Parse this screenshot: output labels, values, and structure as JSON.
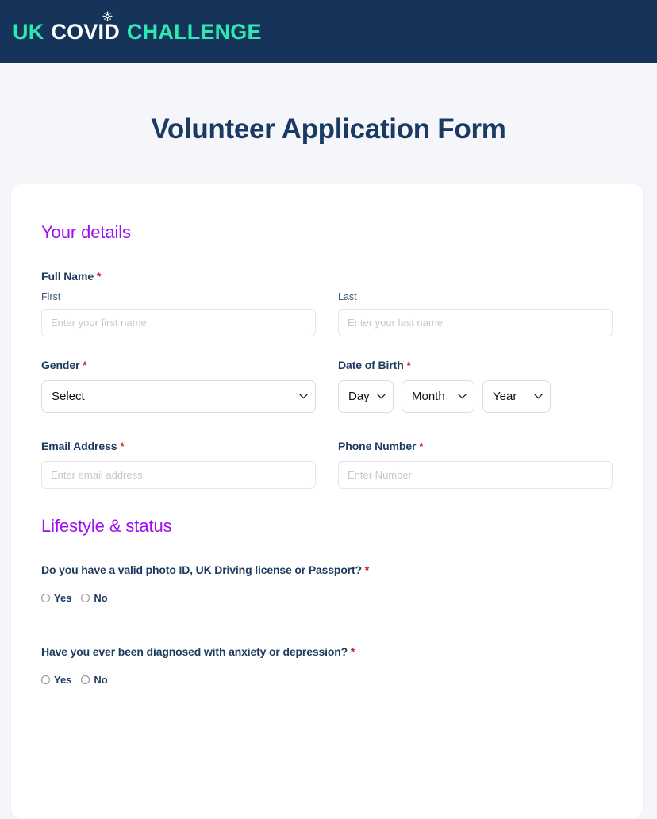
{
  "header": {
    "brand_uk": "UK",
    "brand_covid": "COVID",
    "brand_challenge": "CHALLENGE",
    "virus_icon_name": "coronavirus-icon",
    "background_color": "#163459",
    "accent_color": "#2ee8b0"
  },
  "page": {
    "title": "Volunteer Application Form",
    "title_color": "#1b3a63",
    "background_color": "#f5f6fa"
  },
  "sections": {
    "details": {
      "heading": "Your details",
      "heading_color": "#9d0fec",
      "full_name": {
        "label": "Full Name",
        "required_marker": "*",
        "first": {
          "sub_label": "First",
          "placeholder": "Enter your first name",
          "value": ""
        },
        "last": {
          "sub_label": "Last",
          "placeholder": "Enter your last name",
          "value": ""
        }
      },
      "gender": {
        "label": "Gender",
        "required_marker": "*",
        "selected": "Select"
      },
      "date_of_birth": {
        "label": "Date of Birth",
        "required_marker": "*",
        "day_selected": "Day",
        "month_selected": "Month",
        "year_selected": "Year"
      },
      "email": {
        "label": "Email Address",
        "required_marker": "*",
        "placeholder": "Enter email address",
        "value": ""
      },
      "phone": {
        "label": "Phone Number",
        "required_marker": "*",
        "placeholder": "Enter Number",
        "value": ""
      }
    },
    "lifestyle": {
      "heading": "Lifestyle & status",
      "heading_color": "#9d0fec",
      "questions": [
        {
          "label": "Do you have a valid photo ID, UK Driving license or Passport?",
          "required_marker": "*",
          "options": [
            "Yes",
            "No"
          ],
          "selected": null
        },
        {
          "label": "Have you ever been diagnosed with anxiety or depression?",
          "required_marker": "*",
          "options": [
            "Yes",
            "No"
          ],
          "selected": null
        }
      ]
    }
  }
}
